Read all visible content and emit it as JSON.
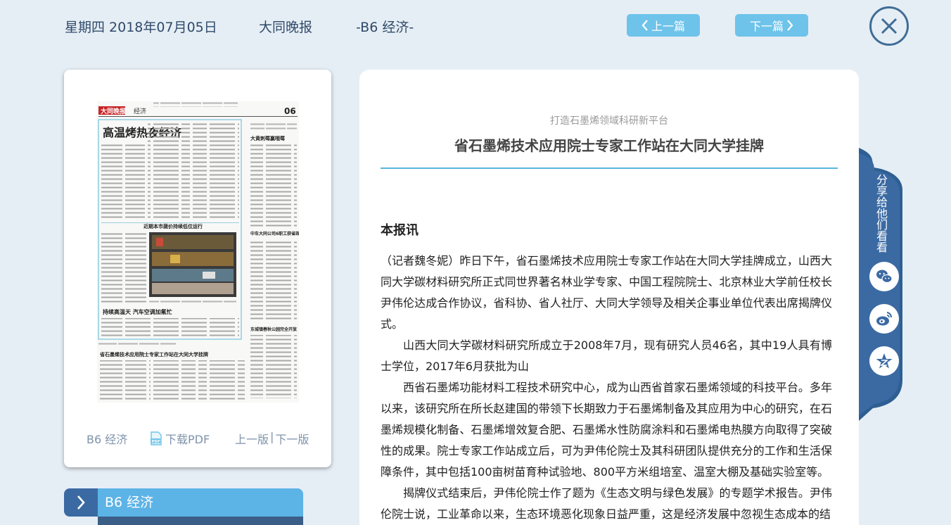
{
  "header": {
    "date": "星期四 2018年07月05日",
    "paper": "大同晚报",
    "section": "-B6 经济-",
    "prev_label": "上一篇",
    "next_label": "下一篇"
  },
  "page_card": {
    "section_label": "B6 经济",
    "download_label": "下载PDF",
    "prev_page_label": "上一版",
    "separator": "|",
    "next_page_label": "下一版"
  },
  "section_bar": {
    "label": "B6 经济"
  },
  "article": {
    "kicker": "打造石墨烯领域科研新平台",
    "title": "省石墨烯技术应用院士专家工作站在大同大学挂牌",
    "lead": "本报讯",
    "paragraphs": [
      "（记者魏冬妮）昨日下午，省石墨烯技术应用院士专家工作站在大同大学挂牌成立，山西大同大学碳材料研究所正式同世界著名林业学专家、中国工程院院士、北京林业大学前任校长尹伟伦达成合作协议，省科协、省人社厅、大同大学领导及相关企事业单位代表出席揭牌仪式。",
      "山西大同大学碳材料研究所成立于2008年7月，现有研究人员46名，其中19人具有博士学位，2017年6月获批为山",
      "西省石墨烯功能材料工程技术研究中心，成为山西省首家石墨烯领域的科技平台。多年以来，该研究所在所长赵建国的带领下长期致力于石墨烯制备及其应用为中心的研究，在石墨烯规模化制备、石墨烯增效复合肥、石墨烯水性防腐涂料和石墨烯电热膜方向取得了突破性的成果。院士专家工作站成立后，可为尹伟伦院士及其科研团队提供充分的工作和生活保障条件，其中包括100亩树苗育种试验地、800平方米组培室、温室大棚及基础实验室等。",
      "揭牌仪式结束后，尹伟伦院士作了题为《生态文明与绿色发展》的专题学术报告。尹伟伦院士说，工业革命以来，生态环境恶化现象日益严重，这是经济发展中忽视生态成本的结"
    ]
  },
  "share": {
    "label": "分享给他们看看",
    "wechat_icon": "wechat-icon",
    "weibo_icon": "weibo-icon",
    "favorite_icon": "favorite-icon"
  },
  "newspaper_thumb": {
    "masthead": "大同晚报",
    "column": "经济",
    "page_no": "06",
    "headline_1": "高温烤热夜经济",
    "headline_2": "近期本市蔬价持续低位运行",
    "headline_3": "持续高温天 汽车空调加氟忙",
    "headline_4": "省石墨烯技术应用院士专家工作站在大同大学挂牌",
    "side_headline_1": "大黄刺莓赢哦莓",
    "side_headline_2": "中车大同公司6职工获省政府“大红包”",
    "side_headline_3": "东城镇春秋公园完全开放"
  },
  "colors": {
    "background": "#e6eef5",
    "accent": "#6ec3ea",
    "dark_blue": "#3b6aa3",
    "divider": "#57b7dc"
  }
}
